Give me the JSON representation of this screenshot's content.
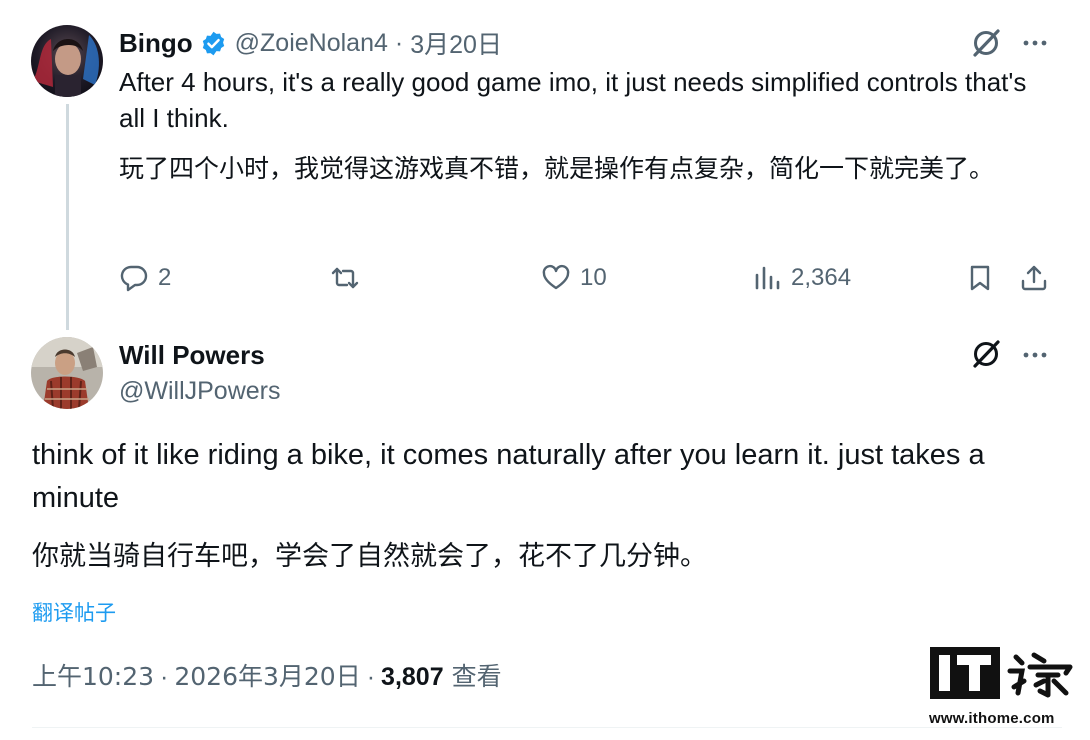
{
  "reply1": {
    "name": "Bingo",
    "handle": "@ZoieNolan4",
    "separator": "·",
    "date": "3月20日",
    "text_en": "After 4 hours, it's a really good game imo, it just needs simplified controls that's all I think.",
    "text_zh": "玩了四个小时，我觉得这游戏真不错，就是操作有点复杂，简化一下就完美了。",
    "actions": {
      "replies": "2",
      "retweets": "",
      "likes": "10",
      "views": "2,364"
    }
  },
  "reply2": {
    "name": "Will Powers",
    "handle": "@WillJPowers",
    "text_en": "think of it like riding a bike, it comes naturally after you learn it. just takes a minute",
    "text_zh": "你就当骑自行车吧，学会了自然就会了，花不了几分钟。",
    "translate_label": "翻译帖子",
    "time": "上午10:23",
    "separator": "·",
    "full_date": "2026年3月20日",
    "view_count": "3,807",
    "view_label": "查看"
  },
  "watermark": {
    "logo_text": "IT之家",
    "url": "www.ithome.com"
  },
  "colors": {
    "text": "#0f1419",
    "secondary": "#536471",
    "accent": "#1d9bf0",
    "thread_line": "#cfd9de"
  },
  "icons": {
    "verified": "verified-badge-icon",
    "grok": "grok-icon",
    "more": "more-dots-icon",
    "reply": "reply-bubble-icon",
    "retweet": "retweet-icon",
    "like": "heart-icon",
    "views": "views-bars-icon",
    "bookmark": "bookmark-icon",
    "share": "share-upload-icon"
  }
}
